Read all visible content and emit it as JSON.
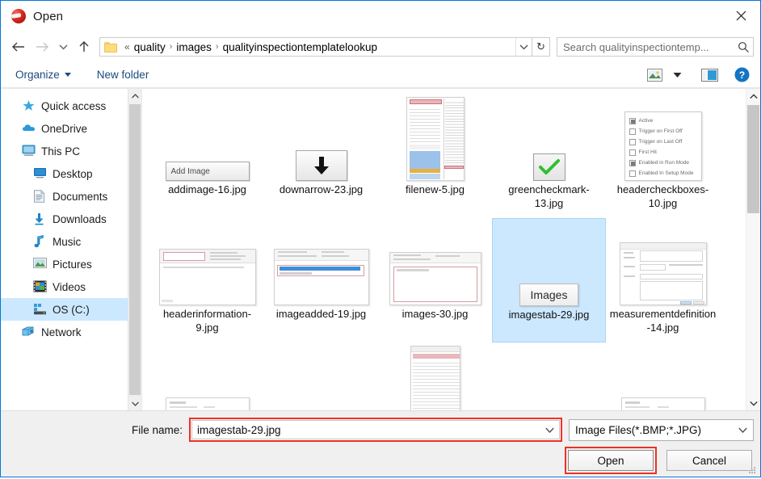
{
  "window": {
    "title": "Open",
    "title_icon": "app-sphere-icon",
    "close_icon": "close-icon",
    "border_color": "#0078d7",
    "accent_highlight_color": "#ee3124",
    "selection_color": "#cce8ff"
  },
  "address_bar": {
    "back_icon": "back-arrow-icon",
    "forward_icon": "forward-arrow-icon",
    "recent_icon": "chevron-down-icon",
    "up_icon": "up-arrow-icon",
    "folder_icon": "folder-icon",
    "leading_separator": "«",
    "crumbs": [
      "quality",
      "images",
      "qualityinspectiontemplatelookup"
    ],
    "separator": "›",
    "dropdown_icon": "chevron-down-icon",
    "refresh_icon": "refresh-icon",
    "refresh_glyph": "↻"
  },
  "search": {
    "placeholder": "Search qualityinspectiontemp...",
    "icon": "search-icon"
  },
  "toolbar": {
    "organize_label": "Organize",
    "new_folder_label": "New folder",
    "view_icon": "view-layout-icon",
    "view_dropdown_icon": "chevron-down-icon",
    "preview_pane_icon": "preview-pane-icon",
    "help_icon": "help-icon",
    "help_glyph": "?"
  },
  "sidebar": {
    "items": [
      {
        "label": "Quick access",
        "icon": "star-icon",
        "indent": false,
        "selected": false
      },
      {
        "label": "OneDrive",
        "icon": "cloud-icon",
        "indent": false,
        "selected": false
      },
      {
        "label": "This PC",
        "icon": "monitor-icon",
        "indent": false,
        "selected": false
      },
      {
        "label": "Desktop",
        "icon": "desktop-icon",
        "indent": true,
        "selected": false
      },
      {
        "label": "Documents",
        "icon": "documents-icon",
        "indent": true,
        "selected": false
      },
      {
        "label": "Downloads",
        "icon": "downloads-icon",
        "indent": true,
        "selected": false
      },
      {
        "label": "Music",
        "icon": "music-icon",
        "indent": true,
        "selected": false
      },
      {
        "label": "Pictures",
        "icon": "pictures-icon",
        "indent": true,
        "selected": false
      },
      {
        "label": "Videos",
        "icon": "videos-icon",
        "indent": true,
        "selected": false
      },
      {
        "label": "OS (C:)",
        "icon": "drive-icon",
        "indent": true,
        "selected": true
      },
      {
        "label": "Network",
        "icon": "network-icon",
        "indent": false,
        "selected": false
      }
    ],
    "scroll_up_icon": "chevron-up-icon",
    "scroll_down_icon": "chevron-down-icon"
  },
  "files": {
    "items": [
      {
        "name": "addimage-16.jpg",
        "thumb": "button-add-image",
        "thumb_text": "Add Image",
        "selected": false
      },
      {
        "name": "downarrow-23.jpg",
        "thumb": "button-down-arrow",
        "selected": false
      },
      {
        "name": "filenew-5.jpg",
        "thumb": "screenshot-tall-list",
        "selected": false
      },
      {
        "name": "greencheckmark-13.jpg",
        "thumb": "green-checkmark",
        "selected": false
      },
      {
        "name": "headercheckboxes-10.jpg",
        "thumb": "checkbox-list",
        "selected": false
      },
      {
        "name": "headerinformation-9.jpg",
        "thumb": "screenshot-form",
        "selected": false
      },
      {
        "name": "imageadded-19.jpg",
        "thumb": "screenshot-form-blue-row",
        "selected": false
      },
      {
        "name": "images-30.jpg",
        "thumb": "screenshot-form-red-box",
        "selected": false
      },
      {
        "name": "imagestab-29.jpg",
        "thumb": "tab-images",
        "thumb_text": "Images",
        "selected": true
      },
      {
        "name": "measurementdefinition-14.jpg",
        "thumb": "screenshot-dialog",
        "selected": false
      }
    ],
    "checkbox_thumb_rows": [
      {
        "label": "Active",
        "checked": true
      },
      {
        "label": "Trigger on First Off",
        "checked": false
      },
      {
        "label": "Trigger on Last Off",
        "checked": false
      },
      {
        "label": "First Hit",
        "checked": false
      },
      {
        "label": "Enabled in Run Mode",
        "checked": true
      },
      {
        "label": "Enabled In Setup Mode",
        "checked": false
      }
    ],
    "scroll_up_icon": "chevron-up-icon",
    "scroll_down_icon": "chevron-down-icon"
  },
  "footer": {
    "file_name_label": "File name:",
    "file_name_value": "imagestab-29.jpg",
    "file_name_dropdown_icon": "chevron-down-icon",
    "file_type_value": "Image Files(*.BMP;*.JPG)",
    "file_type_dropdown_icon": "chevron-down-icon",
    "open_label": "Open",
    "cancel_label": "Cancel",
    "resize_grip_icon": "resize-grip-icon"
  }
}
